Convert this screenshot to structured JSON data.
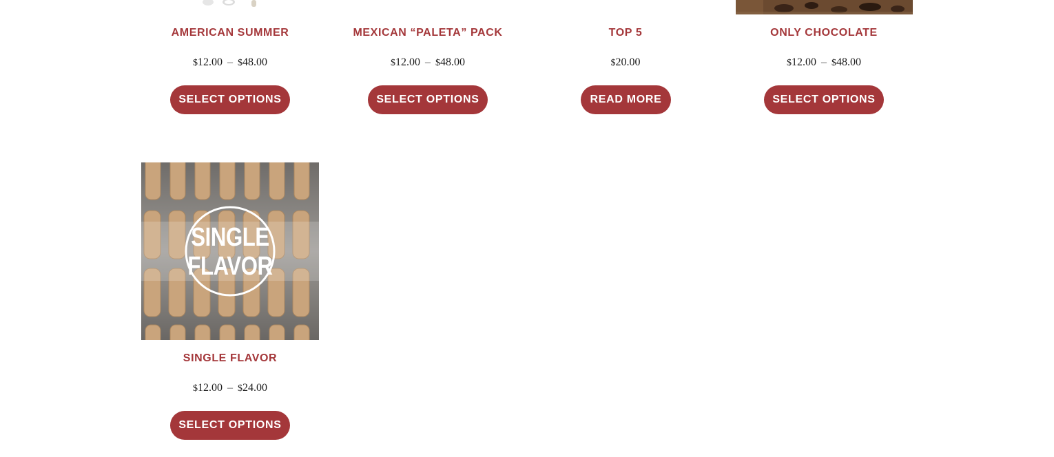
{
  "products": [
    {
      "title": "AMERICAN SUMMER",
      "price_currency_1": "$",
      "price_min": "12.00",
      "price_dash": "–",
      "price_currency_2": "$",
      "price_max": "48.00",
      "button": "SELECT OPTIONS"
    },
    {
      "title": "MEXICAN “PALETA” PACK",
      "price_currency_1": "$",
      "price_min": "12.00",
      "price_dash": "–",
      "price_currency_2": "$",
      "price_max": "48.00",
      "button": "SELECT OPTIONS"
    },
    {
      "title": "TOP 5",
      "price_currency_1": "$",
      "price_min": "20.00",
      "button": "READ MORE"
    },
    {
      "title": "ONLY CHOCOLATE",
      "price_currency_1": "$",
      "price_min": "12.00",
      "price_dash": "–",
      "price_currency_2": "$",
      "price_max": "48.00",
      "button": "SELECT OPTIONS"
    },
    {
      "title": "SINGLE FLAVOR",
      "image_text_line1": "SINGLE",
      "image_text_line2": "FLAVOR",
      "price_currency_1": "$",
      "price_min": "12.00",
      "price_dash": "–",
      "price_currency_2": "$",
      "price_max": "24.00",
      "button": "SELECT OPTIONS"
    }
  ],
  "colors": {
    "accent": "#a4373a",
    "button_text": "#ffffff",
    "price_text": "#1a1a1a"
  }
}
